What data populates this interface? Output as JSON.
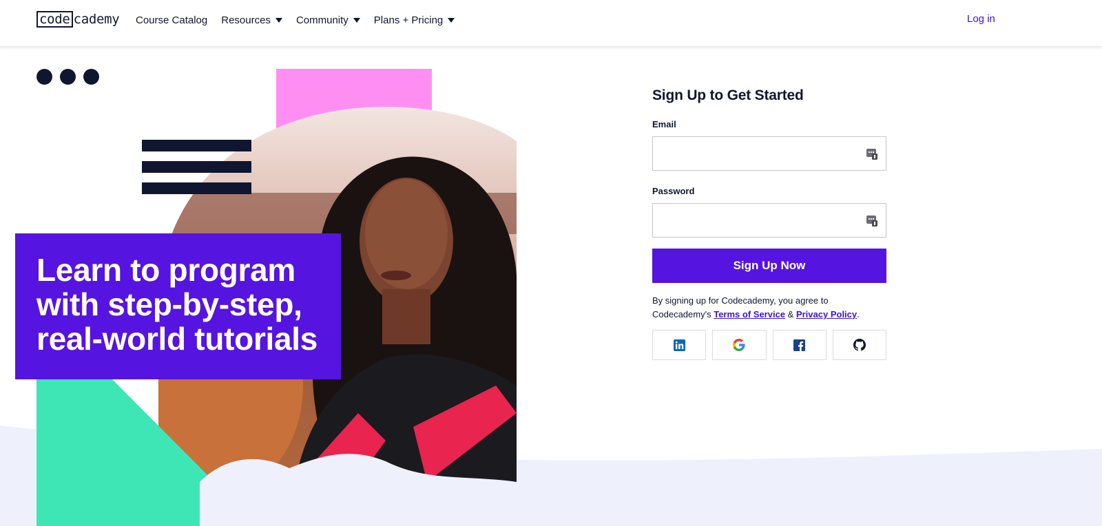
{
  "brand": {
    "logo_boxed": "code",
    "logo_rest": "cademy"
  },
  "nav": {
    "items": [
      {
        "label": "Course Catalog",
        "has_caret": false
      },
      {
        "label": "Resources",
        "has_caret": true
      },
      {
        "label": "Community",
        "has_caret": true
      },
      {
        "label": "Plans + Pricing",
        "has_caret": true
      }
    ],
    "login": "Log in"
  },
  "hero": {
    "headline": "Learn to program with step-by-step, real-world tutorials"
  },
  "signup": {
    "title": "Sign Up to Get Started",
    "email_label": "Email",
    "email_value": "",
    "password_label": "Password",
    "password_value": "",
    "submit_label": "Sign Up Now",
    "terms_prefix": "By signing up for Codecademy, you agree to Codecademy's",
    "terms_link": "Terms of Service",
    "terms_amp": "&",
    "privacy_link": "Privacy Policy",
    "terms_suffix": ".",
    "social_buttons": [
      "linkedin-icon",
      "google-icon",
      "facebook-icon",
      "github-icon"
    ]
  },
  "colors": {
    "brand_purple": "#5514e0",
    "link_blue": "#3a10e5",
    "navy": "#10162f",
    "pink": "#ff8ef3",
    "mint": "#3ee6b6",
    "wave": "#eef0fb"
  }
}
